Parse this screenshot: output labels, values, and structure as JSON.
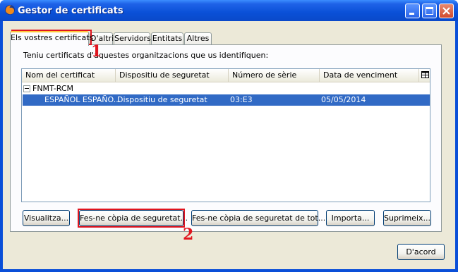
{
  "window": {
    "title": "Gestor de certificats"
  },
  "tabs": [
    {
      "label": "Els vostres certificats"
    },
    {
      "label": "D'altri"
    },
    {
      "label": "Servidors"
    },
    {
      "label": "Entitats"
    },
    {
      "label": "Altres"
    }
  ],
  "panel": {
    "description": "Teniu certificats d'aquestes organitzacions que us identifiquen:",
    "columns": [
      "Nom del certificat",
      "Dispositiu de seguretat",
      "Número de sèrie",
      "Data de venciment"
    ],
    "group": "FNMT-RCM",
    "rows": [
      {
        "name": "ESPAÑOL ESPAÑO...",
        "device": "Dispositiu de seguretat",
        "serial": "03:E3",
        "expiry": "05/05/2014"
      }
    ]
  },
  "buttons": {
    "view": "Visualitza...",
    "backup": "Fes-ne còpia de seguretat...",
    "backup_all": "Fes-ne còpia de seguretat de tot...",
    "import": "Importa...",
    "delete": "Suprimeix...",
    "ok": "D'acord"
  },
  "annotations": [
    "1",
    "2"
  ],
  "colors": {
    "titlebar": "#0a50d7",
    "selection": "#316ac5",
    "annotation": "#e0141e",
    "tab_highlight": "#ffc83c"
  }
}
